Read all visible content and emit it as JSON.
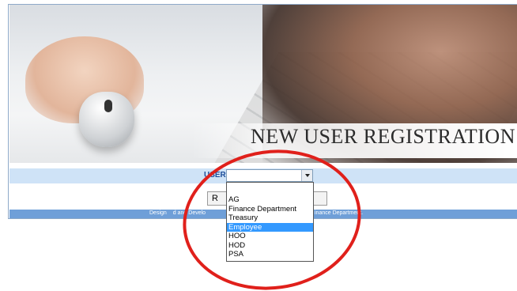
{
  "banner": {
    "title": "NEW USER REGISTRATION"
  },
  "form": {
    "user_label": "USER",
    "selected_value": "",
    "options": [
      "",
      "AG",
      "Finance Department",
      "Treasury",
      "Employee",
      "HOO",
      "HOD",
      "PSA"
    ],
    "highlighted_option": "Employee",
    "button_left_visible_text": "R"
  },
  "footer": {
    "left_text": "Design",
    "left_text2": "d and Develo",
    "right_text": "inance Department."
  },
  "colors": {
    "header_row": "#cfe3f7",
    "footer_bar": "#6f9fd8",
    "label": "#1f4e9a",
    "highlight": "#3399ff",
    "annotation": "#e0201b"
  }
}
